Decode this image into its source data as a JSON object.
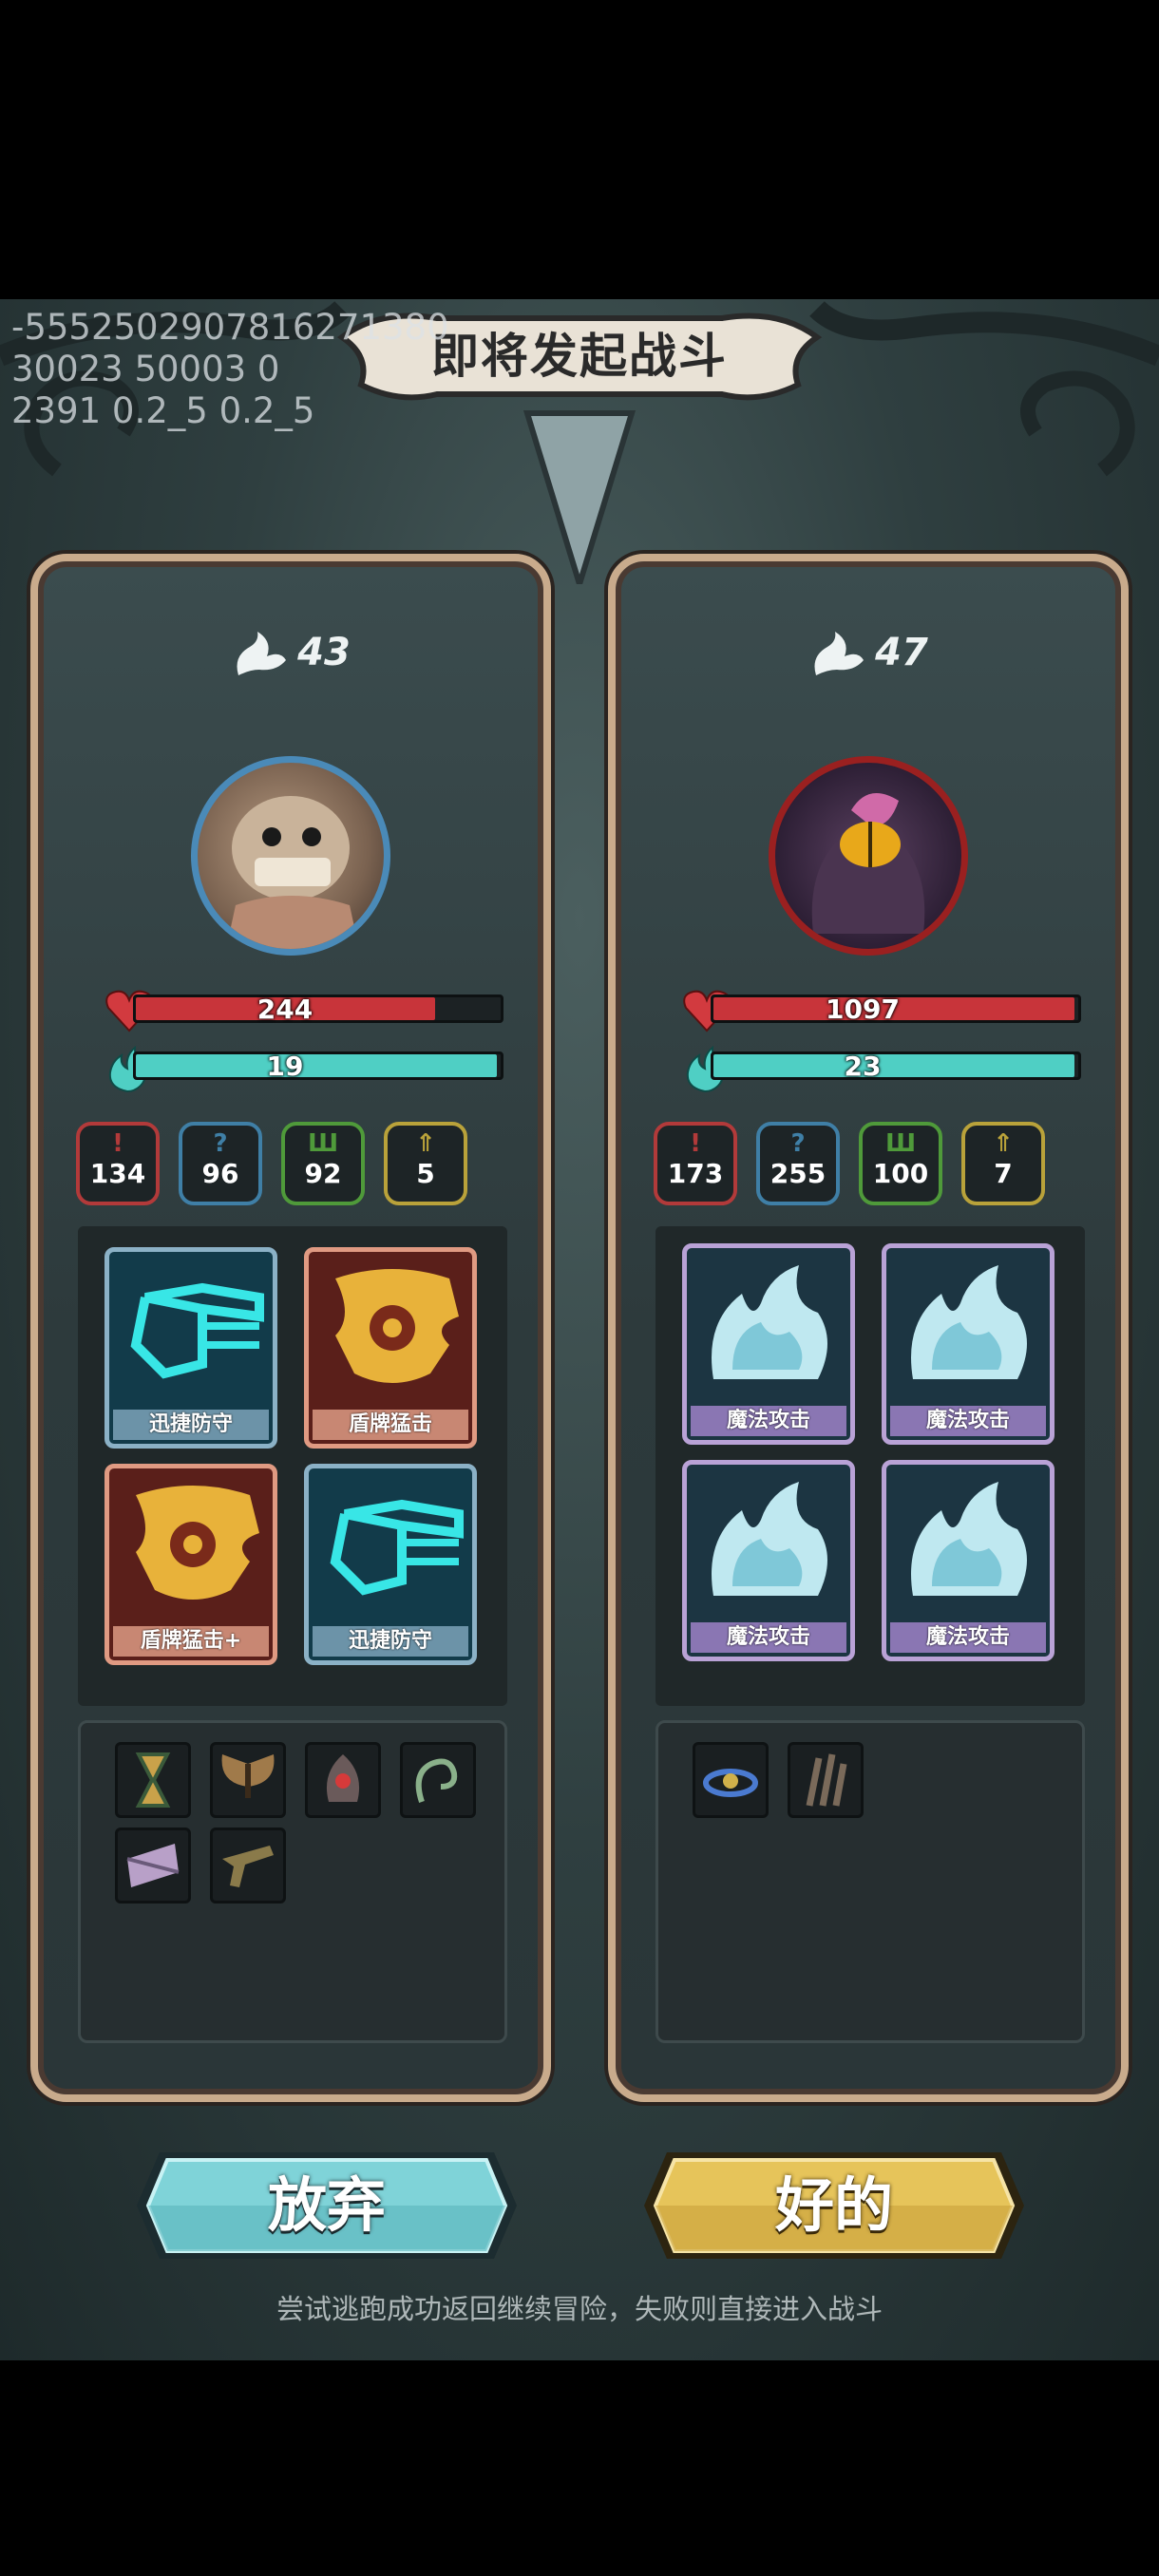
{
  "debug_lines": [
    "-5552502907816271380",
    "30023 50003 0",
    "2391 0.2_5 0.2_5"
  ],
  "title": "即将发起战斗",
  "player": {
    "level": "43",
    "hp": "244",
    "hp_fraction": 0.82,
    "mp": "19",
    "mp_fraction": 0.99,
    "stats": [
      {
        "icon": "attack-icon",
        "value": "134",
        "color": "#b23a3a"
      },
      {
        "icon": "crit-icon",
        "value": "96",
        "color": "#3f7fa6"
      },
      {
        "icon": "defense-icon",
        "value": "92",
        "color": "#4f9a3a"
      },
      {
        "icon": "speed-icon",
        "value": "5",
        "color": "#b9a23a"
      }
    ],
    "cards": [
      "迅捷防守",
      "盾牌猛击",
      "盾牌猛击+",
      "迅捷防守"
    ],
    "items": [
      "hourglass-icon",
      "moth-icon",
      "eye-icon",
      "hook-icon",
      "ribbon-icon",
      "pistol-icon"
    ]
  },
  "enemy": {
    "level": "47",
    "hp": "1097",
    "hp_fraction": 0.99,
    "mp": "23",
    "mp_fraction": 0.99,
    "stats": [
      {
        "icon": "attack-icon",
        "value": "173",
        "color": "#b23a3a"
      },
      {
        "icon": "crit-icon",
        "value": "255",
        "color": "#3f7fa6"
      },
      {
        "icon": "defense-icon",
        "value": "100",
        "color": "#4f9a3a"
      },
      {
        "icon": "speed-icon",
        "value": "7",
        "color": "#b9a23a"
      }
    ],
    "cards": [
      "魔法攻击",
      "魔法攻击",
      "魔法攻击",
      "魔法攻击"
    ],
    "items": [
      "orb-ring-icon",
      "claw-icon"
    ]
  },
  "buttons": {
    "give_up": "放弃",
    "ok": "好的"
  },
  "hint": "尝试逃跑成功返回继续冒险，失败则直接进入战斗",
  "colors": {
    "hp": "#c8343a",
    "mp": "#4fcfc4",
    "btn_teal": "#7fd3d8",
    "btn_gold": "#e6c45a"
  }
}
